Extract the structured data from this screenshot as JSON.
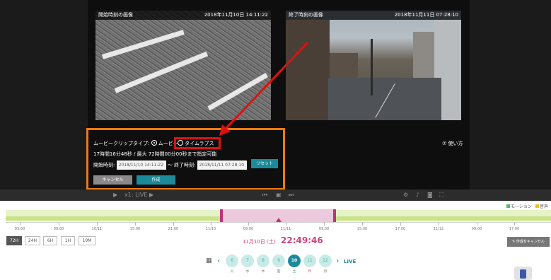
{
  "camera": {
    "start_label": "開始時刻の画像",
    "start_timestamp": "2018年11月10日 14:11:22",
    "end_label": "終了時刻の画像",
    "end_timestamp": "2018年11月11日 07:28:10"
  },
  "clip_settings": {
    "type_label": "ムービークリップタイプ:",
    "option_movie": "ムービー",
    "option_timelapse": "タイムラプス",
    "duration_text": "17時間16分48秒 / 最大 72時間00分00秒まで指定可能",
    "start_label": "開始時刻:",
    "start_value": "2018/11/10 14:11:22",
    "separator": "〜",
    "end_label": "終了時刻:",
    "end_value": "2018/11/11 07:28:10",
    "reset_label": "リセット",
    "cancel_label": "キャンセル",
    "create_label": "作成",
    "howto_label": "使い方"
  },
  "player": {
    "speed": "x1:",
    "live": "LIVE"
  },
  "timeline": {
    "legend_motion": "モーション",
    "legend_sound": "音声",
    "ticks": [
      "03:00",
      "09:00",
      "10/11",
      "15:00",
      "21:00",
      "11/10",
      "09:00",
      "11/11",
      "09:00",
      "15:00",
      "17:00",
      "11/12",
      "09:00",
      "17:00"
    ]
  },
  "ranges": [
    "72H",
    "24H",
    "6H",
    "1H",
    "10M"
  ],
  "active_range": "72H",
  "cancel_create_label": "作成をキャンセル",
  "current": {
    "date": "11月10日 (土)",
    "time": "22:49:46"
  },
  "days": [
    {
      "num": "6",
      "wd": "火"
    },
    {
      "num": "7",
      "wd": "水"
    },
    {
      "num": "8",
      "wd": "木"
    },
    {
      "num": "9",
      "wd": "金"
    },
    {
      "num": "10",
      "wd": "土"
    },
    {
      "num": "11",
      "wd": "日"
    },
    {
      "num": "12",
      "wd": "月"
    }
  ],
  "live_link": "LIVE",
  "colors": {
    "accent": "#1b8a9a",
    "highlight_orange": "#f07a10",
    "highlight_red": "#e01010",
    "selection_pink": "#c2307a",
    "time_pink": "#d6417a"
  }
}
